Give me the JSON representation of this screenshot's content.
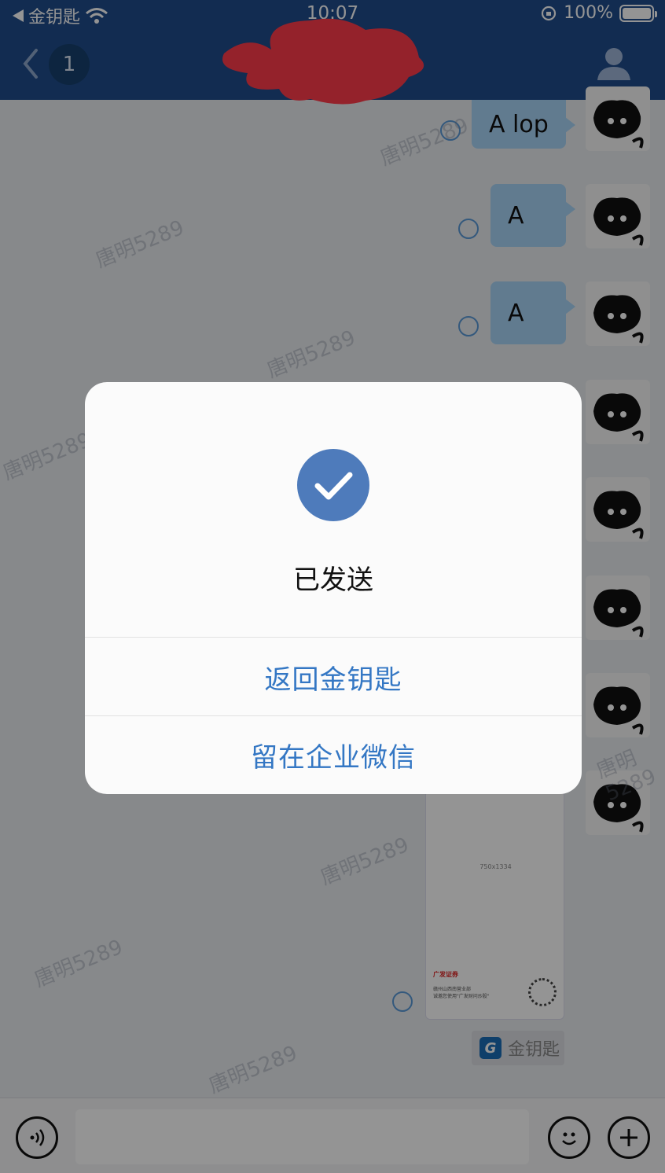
{
  "status_bar": {
    "back_app_label": "金钥匙",
    "time": "10:07",
    "battery_percent": "100%",
    "battery_level": 1.0
  },
  "nav": {
    "unread_count": "1"
  },
  "messages": [
    {
      "text": "A lop"
    },
    {
      "text": "A"
    },
    {
      "text": "A"
    }
  ],
  "watermark_text": "唐明5289",
  "card": {
    "size_text": "750x1334",
    "brand": "广发证券",
    "desc_line1": "赣州山西南营业部",
    "desc_line2": "诚邀您使用\"广发财问炒股\""
  },
  "app_message": {
    "label": "金钥匙",
    "logo_glyph": "G"
  },
  "dialog": {
    "title": "已发送",
    "button_primary": "返回金钥匙",
    "button_secondary": "留在企业微信",
    "accent_color": "#3477c4",
    "check_color": "#4e7bbb"
  },
  "colors": {
    "nav_bg": "#1f4d8c",
    "bubble_bg": "#a8d4f6"
  }
}
